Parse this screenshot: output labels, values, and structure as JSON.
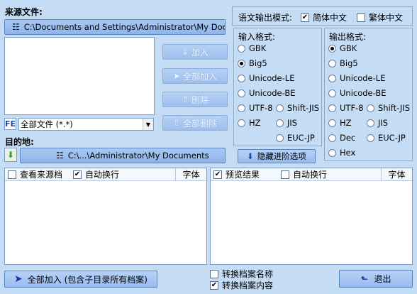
{
  "source": {
    "label": "来源文件:",
    "path": "C:\\Documents and Settings\\Administrator\\My Documents"
  },
  "actions": {
    "add": "加入",
    "add_all": "全部加入",
    "remove": "删除",
    "remove_all": "全部删除"
  },
  "filter": {
    "fe_badge": "FE",
    "selected": "全部文件 (*.*)"
  },
  "destination": {
    "label": "目的地:",
    "path": "C:\\...\\Administrator\\My Documents"
  },
  "output_mode": {
    "label": "语文输出模式:",
    "simplified": "简体中文",
    "traditional": "繁体中文",
    "simplified_checked": true,
    "traditional_checked": false
  },
  "input_format": {
    "title": "输入格式:",
    "options": [
      "GBK",
      "Big5",
      "Unicode-LE",
      "Unicode-BE",
      "UTF-8",
      "Shift-JIS",
      "HZ",
      "JIS",
      "EUC-JP"
    ],
    "selected": "Big5"
  },
  "output_format": {
    "title": "输出格式:",
    "options": [
      "GBK",
      "Big5",
      "Unicode-LE",
      "Unicode-BE",
      "UTF-8",
      "Shift-JIS",
      "HZ",
      "JIS",
      "Dec",
      "EUC-JP",
      "Hex"
    ],
    "selected": "GBK"
  },
  "hide_advanced": "隐藏进阶选项",
  "source_panel": {
    "view_source": "查看来源档",
    "view_source_checked": false,
    "auto_wrap": "自动换行",
    "auto_wrap_checked": true,
    "font": "字体"
  },
  "preview_panel": {
    "preview": "预览结果",
    "preview_checked": true,
    "auto_wrap": "自动换行",
    "auto_wrap_checked": false,
    "font": "字体"
  },
  "bottom": {
    "add_all_sub": "全部加入 (包含子目录所有档案)",
    "convert_name": "转换档案名称",
    "convert_name_checked": false,
    "convert_content": "转换档案内容",
    "convert_content_checked": true,
    "exit": "退出"
  }
}
